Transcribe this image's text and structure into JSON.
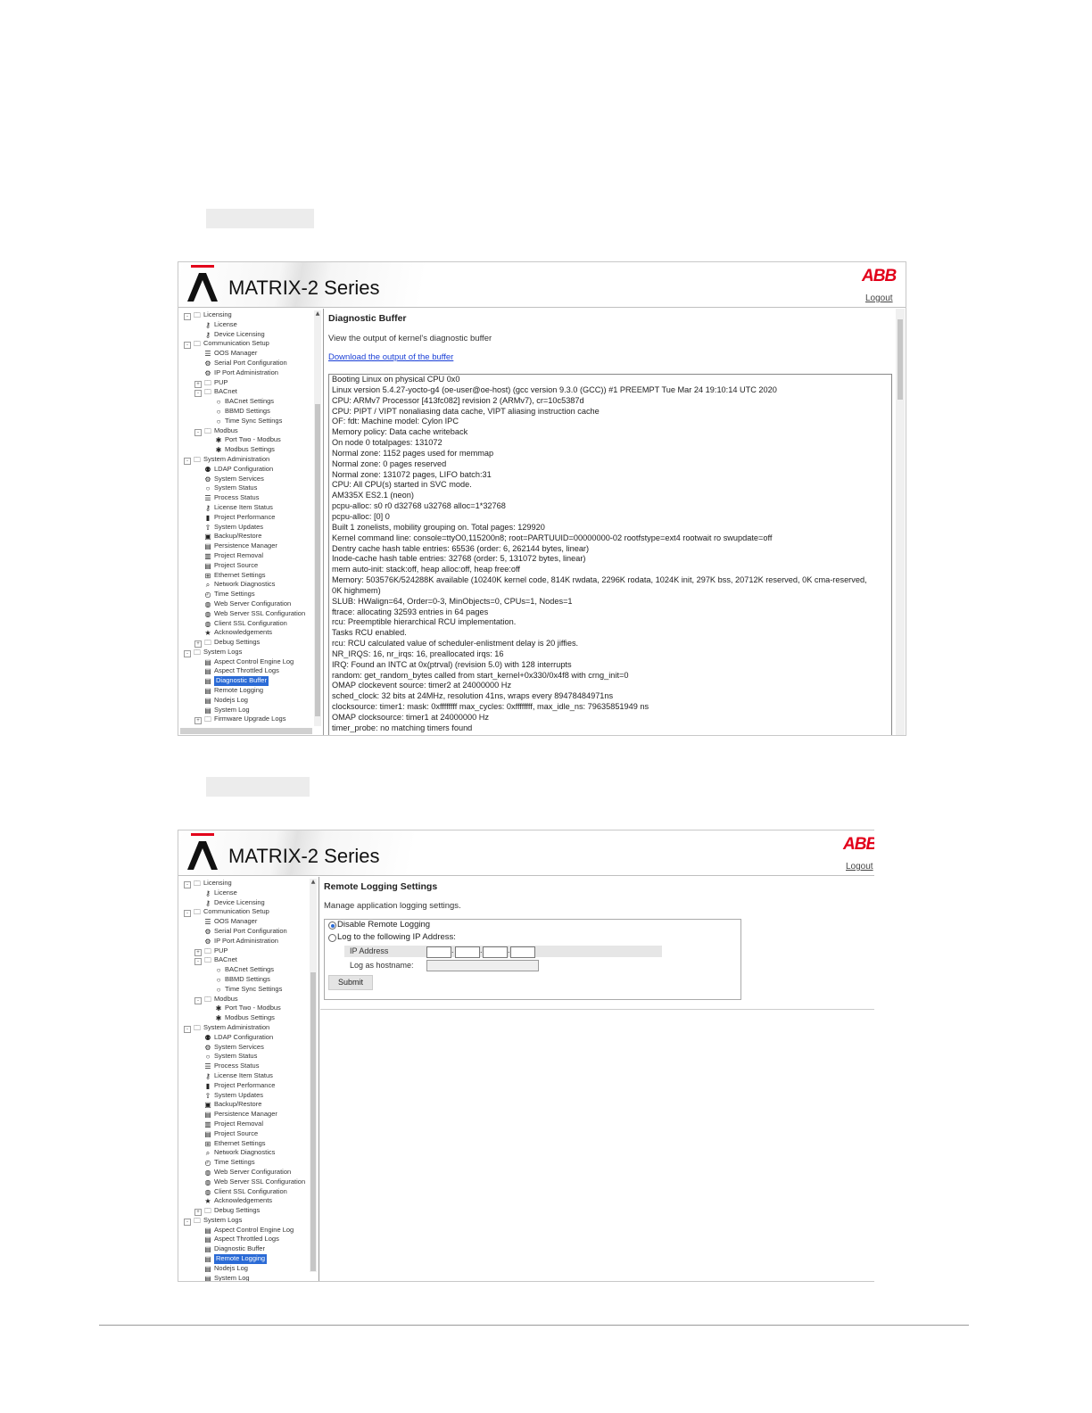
{
  "brand": {
    "title": "MATRIX-2 Series",
    "company": "ABB",
    "logout": "Logout"
  },
  "tree": [
    {
      "label": "Licensing",
      "level": 0,
      "toggle": "-",
      "icon": "folder"
    },
    {
      "label": "License",
      "level": 1,
      "icon": "key"
    },
    {
      "label": "Device Licensing",
      "level": 1,
      "icon": "key"
    },
    {
      "label": "Communication Setup",
      "level": 0,
      "toggle": "-",
      "icon": "folder"
    },
    {
      "label": "OOS Manager",
      "level": 1,
      "icon": "list"
    },
    {
      "label": "Serial Port Configuration",
      "level": 1,
      "icon": "gear"
    },
    {
      "label": "IP Port Administration",
      "level": 1,
      "icon": "gear"
    },
    {
      "label": "PUP",
      "level": 1,
      "toggle": "+",
      "icon": "folder"
    },
    {
      "label": "BACnet",
      "level": 1,
      "toggle": "-",
      "icon": "folder"
    },
    {
      "label": "BACnet Settings",
      "level": 2,
      "icon": "circle"
    },
    {
      "label": "BBMD Settings",
      "level": 2,
      "icon": "circle"
    },
    {
      "label": "Time Sync Settings",
      "level": 2,
      "icon": "circle"
    },
    {
      "label": "Modbus",
      "level": 1,
      "toggle": "-",
      "icon": "folder"
    },
    {
      "label": "Port Two - Modbus",
      "level": 2,
      "icon": "snow"
    },
    {
      "label": "Modbus Settings",
      "level": 2,
      "icon": "snow"
    },
    {
      "label": "System Administration",
      "level": 0,
      "toggle": "-",
      "icon": "folder"
    },
    {
      "label": "LDAP Configuration",
      "level": 1,
      "icon": "users"
    },
    {
      "label": "System Services",
      "level": 1,
      "icon": "gear"
    },
    {
      "label": "System Status",
      "level": 1,
      "icon": "circle"
    },
    {
      "label": "Process Status",
      "level": 1,
      "icon": "list"
    },
    {
      "label": "License Item Status",
      "level": 1,
      "icon": "key"
    },
    {
      "label": "Project Performance",
      "level": 1,
      "icon": "chart"
    },
    {
      "label": "System Updates",
      "level": 1,
      "icon": "upload"
    },
    {
      "label": "Backup/Restore",
      "level": 1,
      "icon": "save"
    },
    {
      "label": "Persistence Manager",
      "level": 1,
      "icon": "doc"
    },
    {
      "label": "Project Removal",
      "level": 1,
      "icon": "trash"
    },
    {
      "label": "Project Source",
      "level": 1,
      "icon": "doc"
    },
    {
      "label": "Ethernet Settings",
      "level": 1,
      "icon": "network"
    },
    {
      "label": "Network Diagnostics",
      "level": 1,
      "icon": "search"
    },
    {
      "label": "Time Settings",
      "level": 1,
      "icon": "clock"
    },
    {
      "label": "Web Server Configuration",
      "level": 1,
      "icon": "globe"
    },
    {
      "label": "Web Server SSL Configuration",
      "level": 1,
      "icon": "globe"
    },
    {
      "label": "Client SSL Configuration",
      "level": 1,
      "icon": "globe"
    },
    {
      "label": "Acknowledgements",
      "level": 1,
      "icon": "star"
    },
    {
      "label": "Debug Settings",
      "level": 1,
      "toggle": "+",
      "icon": "folder"
    },
    {
      "label": "System Logs",
      "level": 0,
      "toggle": "-",
      "icon": "folder"
    },
    {
      "label": "Aspect Control Engine Log",
      "level": 1,
      "icon": "doc"
    },
    {
      "label": "Aspect Throttled Logs",
      "level": 1,
      "icon": "doc"
    },
    {
      "label": "Diagnostic Buffer",
      "level": 1,
      "icon": "doc",
      "sel1": true
    },
    {
      "label": "Remote Logging",
      "level": 1,
      "icon": "doc",
      "sel2": true
    },
    {
      "label": "Nodejs Log",
      "level": 1,
      "icon": "doc"
    },
    {
      "label": "System Log",
      "level": 1,
      "icon": "doc"
    },
    {
      "label": "Firmware Upgrade Logs",
      "level": 1,
      "toggle": "+",
      "icon": "folder"
    }
  ],
  "diag": {
    "title": "Diagnostic Buffer",
    "desc": "View the output of kernel's diagnostic buffer",
    "link": "Download the output of the buffer",
    "lines": [
      "Booting Linux on physical CPU 0x0",
      "Linux version 5.4.27-yocto-g4 (oe-user@oe-host) (gcc version 9.3.0 (GCC)) #1 PREEMPT Tue Mar 24 19:10:14 UTC 2020",
      "CPU: ARMv7 Processor [413fc082] revision 2 (ARMv7), cr=10c5387d",
      "CPU: PIPT / VIPT nonaliasing data cache, VIPT aliasing instruction cache",
      "OF: fdt: Machine model: Cylon IPC",
      "Memory policy: Data cache writeback",
      "On node 0 totalpages: 131072",
      "Normal zone: 1152 pages used for memmap",
      "Normal zone: 0 pages reserved",
      "Normal zone: 131072 pages, LIFO batch:31",
      "CPU: All CPU(s) started in SVC mode.",
      "AM335X ES2.1 (neon)",
      "pcpu-alloc: s0 r0 d32768 u32768 alloc=1*32768",
      "pcpu-alloc: [0] 0",
      "Built 1 zonelists, mobility grouping on.  Total pages: 129920",
      "Kernel command line: console=ttyO0,115200n8; root=PARTUUID=00000000-02 rootfstype=ext4 rootwait ro swupdate=off",
      "Dentry cache hash table entries: 65536 (order: 6, 262144 bytes, linear)",
      "Inode-cache hash table entries: 32768 (order: 5, 131072 bytes, linear)",
      "mem auto-init: stack:off, heap alloc:off, heap free:off",
      "Memory: 503576K/524288K available (10240K kernel code, 814K rwdata, 2296K rodata, 1024K init, 297K bss, 20712K reserved, 0K cma-reserved, 0K highmem)",
      "SLUB: HWalign=64, Order=0-3, MinObjects=0, CPUs=1, Nodes=1",
      "ftrace: allocating 32593 entries in 64 pages",
      "rcu: Preemptible hierarchical RCU implementation.",
      "Tasks RCU enabled.",
      "rcu: RCU calculated value of scheduler-enlistment delay is 20 jiffies.",
      "NR_IRQS: 16, nr_irqs: 16, preallocated irqs: 16",
      "IRQ: Found an INTC at 0x(ptrval) (revision 5.0) with 128 interrupts",
      "random: get_random_bytes called from start_kernel+0x330/0x4f8 with crng_init=0",
      "OMAP clockevent source: timer2 at 24000000 Hz",
      "sched_clock: 32 bits at 24MHz, resolution 41ns, wraps every 89478484971ns",
      "clocksource: timer1: mask: 0xffffffff max_cycles: 0xffffffff, max_idle_ns: 79635851949 ns",
      "OMAP clocksource: timer1 at 24000000 Hz",
      "timer_probe: no matching timers found"
    ]
  },
  "remote": {
    "title": "Remote Logging Settings",
    "desc": "Manage application logging settings.",
    "opt_disable": "Disable Remote Logging",
    "opt_log": "Log to the following IP Address:",
    "ip_label": "IP Address",
    "ip_sep": ".",
    "hostname_label": "Log as hostname:",
    "submit": "Submit"
  }
}
